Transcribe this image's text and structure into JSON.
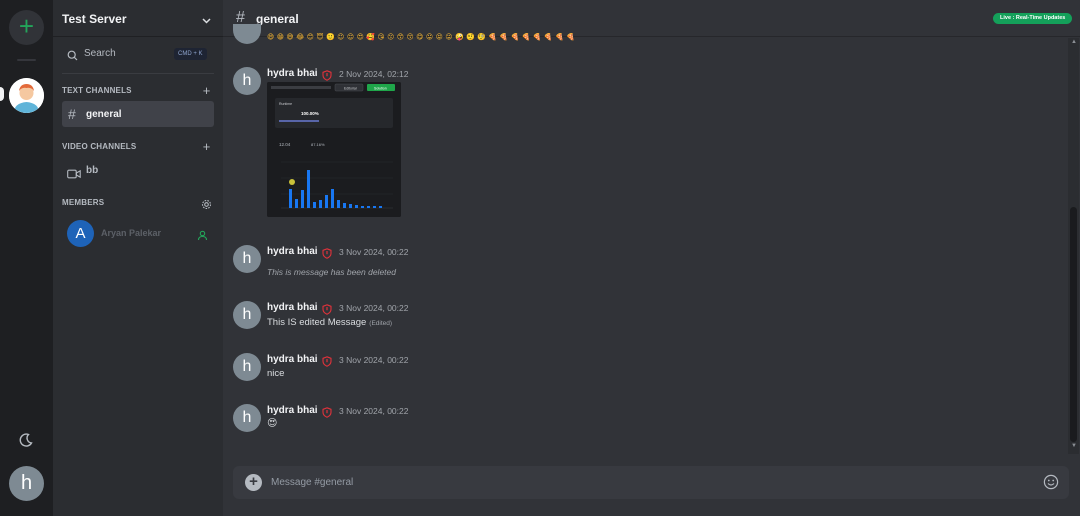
{
  "rail": {
    "add_label": "+",
    "user_initial": "h"
  },
  "sidebar": {
    "server_name": "Test Server",
    "search_label": "Search",
    "search_shortcut": "CMD + K",
    "text_channels_label": "TEXT CHANNELS",
    "active_channel": "general",
    "video_channels_label": "VIDEO CHANNELS",
    "video_channel": "bb",
    "members_label": "MEMBERS",
    "members": [
      {
        "initial": "A",
        "name": "Aryan Palekar",
        "status_color": "#23a55a"
      }
    ]
  },
  "header": {
    "channel": "general",
    "badge": "Live : Real-Time Updates"
  },
  "messages": [
    {
      "initial": "h",
      "author": "hydra bhai",
      "time": "2 Nov 2024, 02:12",
      "text": "",
      "has_image": true
    },
    {
      "initial": "h",
      "author": "hydra bhai",
      "time": "3 Nov 2024, 00:22",
      "text": "This is message has been deleted",
      "deleted": true
    },
    {
      "initial": "h",
      "author": "hydra bhai",
      "time": "3 Nov 2024, 00:22",
      "text": "This IS edited Message",
      "edited": "(Edited)"
    },
    {
      "initial": "h",
      "author": "hydra bhai",
      "time": "3 Nov 2024, 00:22",
      "text": "nice"
    },
    {
      "initial": "h",
      "author": "hydra bhai",
      "time": "3 Nov 2024, 00:22",
      "text": "😍"
    }
  ],
  "emoji_strip": "😄😁😅😂😊😇🙂😉😌😍🥰😘😗😙😚😋😛😝😜🤪🤨🧐🍕🍕🍕🍕🍕🍕🍕🍕",
  "embed": {
    "btn_a": "Editorial",
    "btn_b": "Solution",
    "box_title": "Runtime",
    "box_value": "100.00%",
    "mem_value": "12.04",
    "mem_pct": "87.16%"
  },
  "composer": {
    "placeholder": "Message #general"
  },
  "colors": {
    "accent_green": "#23a55a",
    "badge_green": "#14a05a",
    "shield_red": "#e0323b",
    "member_blue": "#1e63b8"
  }
}
